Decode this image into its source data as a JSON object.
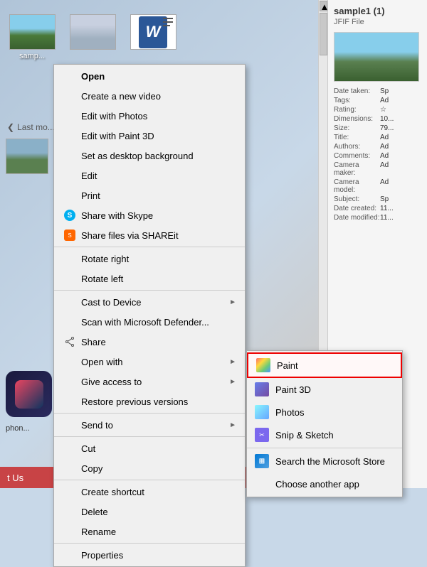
{
  "desktop": {
    "icons": [
      {
        "label": "samp...",
        "type": "landscape"
      },
      {
        "label": "",
        "type": "landscape2"
      },
      {
        "label": "",
        "type": "word"
      }
    ]
  },
  "rightPanel": {
    "title": "sample1 (1)",
    "subtitle": "JFIF File",
    "properties": [
      {
        "key": "Date taken:",
        "val": "Sp"
      },
      {
        "key": "Tags:",
        "val": "Ad"
      },
      {
        "key": "Rating:",
        "val": "☆"
      },
      {
        "key": "Dimensions:",
        "val": "10..."
      },
      {
        "key": "Size:",
        "val": "79..."
      },
      {
        "key": "Title:",
        "val": "Ad"
      },
      {
        "key": "Authors:",
        "val": "Ad"
      },
      {
        "key": "Comments:",
        "val": "Ad"
      },
      {
        "key": "Camera maker:",
        "val": "Ad"
      },
      {
        "key": "Camera model:",
        "val": "Ad"
      },
      {
        "key": "Subject:",
        "val": "Sp"
      },
      {
        "key": "Date created:",
        "val": "11..."
      },
      {
        "key": "Date modified:",
        "val": "11..."
      }
    ]
  },
  "contextMenu": {
    "items": [
      {
        "id": "open",
        "label": "Open",
        "bold": true,
        "icon": null,
        "hasArrow": false
      },
      {
        "id": "new-video",
        "label": "Create a new video",
        "icon": null,
        "hasArrow": false
      },
      {
        "id": "edit-photos",
        "label": "Edit with Photos",
        "icon": null,
        "hasArrow": false
      },
      {
        "id": "edit-paint3d",
        "label": "Edit with Paint 3D",
        "icon": null,
        "hasArrow": false
      },
      {
        "id": "desktop-bg",
        "label": "Set as desktop background",
        "icon": null,
        "hasArrow": false
      },
      {
        "id": "edit",
        "label": "Edit",
        "icon": null,
        "hasArrow": false
      },
      {
        "id": "print",
        "label": "Print",
        "icon": null,
        "hasArrow": false
      },
      {
        "id": "share-skype",
        "label": "Share with Skype",
        "icon": "skype",
        "hasArrow": false
      },
      {
        "id": "share-shareit",
        "label": "Share files via SHAREit",
        "icon": "shareit",
        "hasArrow": false
      },
      {
        "id": "rotate-right",
        "label": "Rotate right",
        "icon": null,
        "hasArrow": false
      },
      {
        "id": "rotate-left",
        "label": "Rotate left",
        "icon": null,
        "hasArrow": false
      },
      {
        "id": "cast",
        "label": "Cast to Device",
        "icon": null,
        "hasArrow": true
      },
      {
        "id": "defender",
        "label": "Scan with Microsoft Defender...",
        "icon": null,
        "hasArrow": false
      },
      {
        "id": "share",
        "label": "Share",
        "icon": "share",
        "hasArrow": false
      },
      {
        "id": "open-with",
        "label": "Open with",
        "icon": null,
        "hasArrow": true
      },
      {
        "id": "give-access",
        "label": "Give access to",
        "icon": null,
        "hasArrow": true
      },
      {
        "id": "restore-prev",
        "label": "Restore previous versions",
        "icon": null,
        "hasArrow": false
      },
      {
        "id": "send-to",
        "label": "Send to",
        "icon": null,
        "hasArrow": true
      },
      {
        "id": "cut",
        "label": "Cut",
        "icon": null,
        "hasArrow": false
      },
      {
        "id": "copy",
        "label": "Copy",
        "icon": null,
        "hasArrow": false
      },
      {
        "id": "create-shortcut",
        "label": "Create shortcut",
        "icon": null,
        "hasArrow": false
      },
      {
        "id": "delete",
        "label": "Delete",
        "icon": null,
        "hasArrow": false
      },
      {
        "id": "rename",
        "label": "Rename",
        "icon": null,
        "hasArrow": false
      },
      {
        "id": "properties",
        "label": "Properties",
        "icon": null,
        "hasArrow": false
      }
    ]
  },
  "submenu": {
    "title": "Open with",
    "items": [
      {
        "id": "paint",
        "label": "Paint",
        "icon": "paint",
        "highlighted": true
      },
      {
        "id": "paint3d",
        "label": "Paint 3D",
        "icon": "paint3d",
        "highlighted": false
      },
      {
        "id": "photos",
        "label": "Photos",
        "icon": "photos",
        "highlighted": false
      },
      {
        "id": "snip",
        "label": "Snip & Sketch",
        "icon": "snip",
        "highlighted": false
      }
    ],
    "separator": true,
    "extraItems": [
      {
        "id": "search-store",
        "label": "Search the Microsoft Store",
        "icon": "store"
      },
      {
        "id": "choose-app",
        "label": "Choose another app",
        "icon": null
      }
    ]
  },
  "sections": {
    "lastModified": "Last mo...",
    "contactUs": "t Us"
  }
}
